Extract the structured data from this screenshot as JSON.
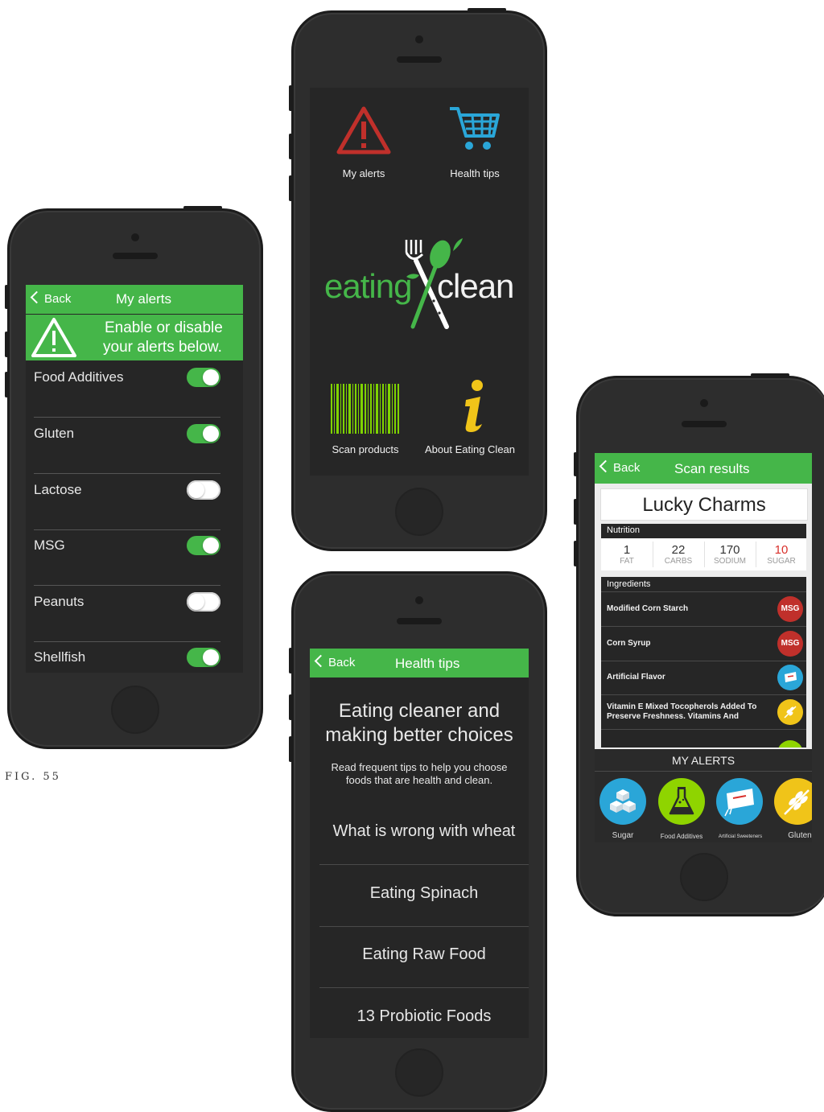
{
  "alerts_screen": {
    "back_label": "Back",
    "title": "My alerts",
    "banner_line1": "Enable or disable",
    "banner_line2": "your alerts below.",
    "items": [
      {
        "label": "Food Additives",
        "enabled": true
      },
      {
        "label": "Gluten",
        "enabled": true
      },
      {
        "label": "Lactose",
        "enabled": false
      },
      {
        "label": "MSG",
        "enabled": true
      },
      {
        "label": "Peanuts",
        "enabled": false
      },
      {
        "label": "Shellfish",
        "enabled": true
      }
    ]
  },
  "home_screen": {
    "my_alerts_label": "My alerts",
    "health_tips_label": "Health tips",
    "logo_left": "eating",
    "logo_right": "clean",
    "scan_label": "Scan products",
    "about_label": "About Eating Clean",
    "colors": {
      "alert_red": "#c0302b",
      "cart_blue": "#2aa6d8",
      "logo_green": "#45b649",
      "info_yellow": "#f0c419"
    }
  },
  "tips_screen": {
    "back_label": "Back",
    "title": "Health tips",
    "heading_line1": "Eating cleaner and",
    "heading_line2": "making better choices",
    "sub_line1": "Read frequent tips to help you choose",
    "sub_line2": "foods that are health and clean.",
    "tips": [
      "What is wrong with wheat",
      "Eating Spinach",
      "Eating Raw Food",
      "13 Probiotic Foods"
    ]
  },
  "scan_screen": {
    "back_label": "Back",
    "title": "Scan results",
    "product": "Lucky Charms",
    "nutrition_header": "Nutrition",
    "nutrition": [
      {
        "value": "1",
        "key": "FAT",
        "highlight": false
      },
      {
        "value": "22",
        "key": "CARBS",
        "highlight": false
      },
      {
        "value": "170",
        "key": "SODIUM",
        "highlight": false
      },
      {
        "value": "10",
        "key": "SUGAR",
        "highlight": true
      }
    ],
    "ingredients_header": "Ingredients",
    "ingredients": [
      {
        "line1": "Modified Corn Starch",
        "line2": "",
        "badge": "MSG",
        "badge_color": "#c0302b"
      },
      {
        "line1": "Corn Syrup",
        "line2": "",
        "badge": "MSG",
        "badge_color": "#c0302b"
      },
      {
        "line1": "Artificial Flavor",
        "line2": "",
        "badge": "",
        "badge_color": "#2aa6d8"
      },
      {
        "line1": "Vitamin E Mixed Tocopherols Added To",
        "line2": "Preserve Freshness. Vitamins And",
        "badge": "",
        "badge_color": "#f0c419"
      }
    ],
    "my_alerts_header": "MY ALERTS",
    "alerts": [
      {
        "label": "Sugar",
        "color": "#2aa6d8",
        "icon": "sugar-cubes-icon"
      },
      {
        "label": "Food Additives",
        "color": "#8fd400",
        "icon": "flask-icon"
      },
      {
        "label": "Artificial Sweeteners",
        "color": "#2aa6d8",
        "icon": "sweetener-packet-icon"
      },
      {
        "label": "Gluten",
        "color": "#f0c419",
        "icon": "wheat-icon"
      }
    ]
  },
  "caption": "FIG. 55"
}
